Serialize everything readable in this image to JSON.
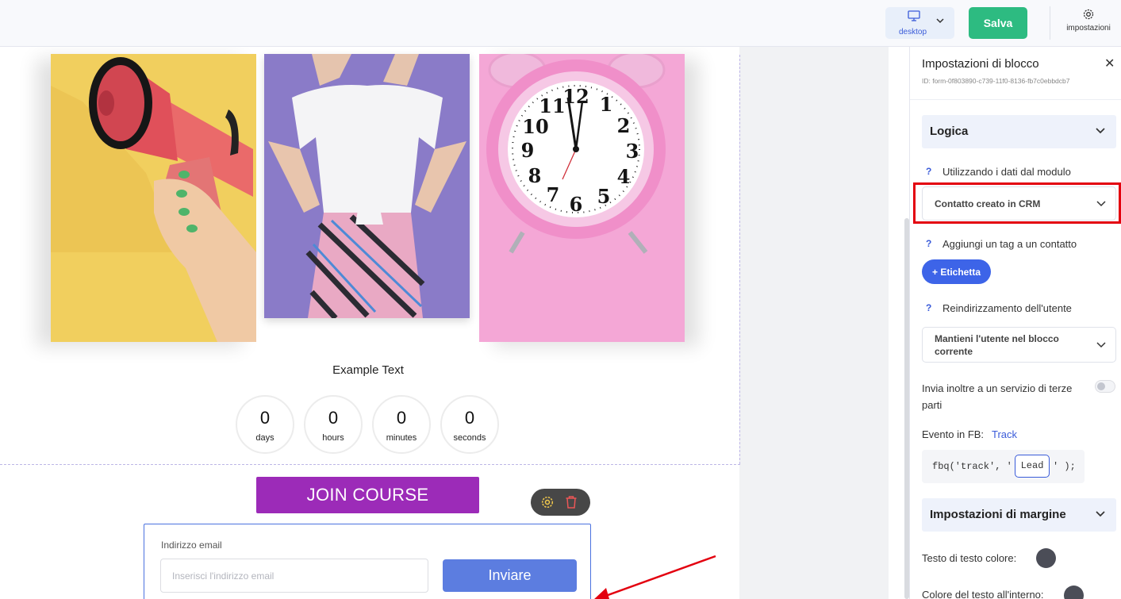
{
  "topbar": {
    "device_label": "desktop",
    "save_label": "Salva",
    "settings_label": "impostazioni"
  },
  "canvas": {
    "example_text": "Example Text",
    "countdown": [
      {
        "value": "0",
        "unit": "days"
      },
      {
        "value": "0",
        "unit": "hours"
      },
      {
        "value": "0",
        "unit": "minutes"
      },
      {
        "value": "0",
        "unit": "seconds"
      }
    ],
    "join_label": "JOIN COURSE",
    "form": {
      "email_label": "Indirizzo email",
      "email_placeholder": "Inserisci l'indirizzo email",
      "submit_label": "Inviare"
    }
  },
  "panel": {
    "title": "Impostazioni di blocco",
    "close_glyph": "✕",
    "block_id": "ID: form-0f803890-c739-11f0-8136-fb7c0ebbdcb7",
    "logic_section": "Logica",
    "help_glyph": "?",
    "using_data_label": "Utilizzando i dati dal modulo",
    "using_data_value": "Contatto creato in CRM",
    "add_tag_label": "Aggiungi un tag a un contatto",
    "tag_button": "+ Etichetta",
    "redirect_label": "Reindirizzamento dell'utente",
    "redirect_value_line1": "Mantieni l'utente nel blocco",
    "redirect_value_line2": "corrente",
    "third_party_line1": "Invia inoltre a un servizio di terze",
    "third_party_line2": "parti",
    "third_party_enabled": false,
    "fb_event_label": "Evento in FB:",
    "fb_event_link": "Track",
    "fbq_prefix": "fbq('track', '",
    "fbq_value": "Lead",
    "fbq_suffix": "' );",
    "margin_section": "Impostazioni di margine",
    "text_color_label": "Testo di testo colore:",
    "text_color": "#4b4d57",
    "inner_text_color_label": "Colore del testo all'interno:",
    "inner_text_color": "#4b4d57"
  },
  "colors": {
    "save_green": "#2dbb81",
    "join_purple": "#9c2bb8",
    "submit_blue": "#5c7de0",
    "accent_blue": "#3d64e8",
    "highlight_red": "#e3000f"
  }
}
